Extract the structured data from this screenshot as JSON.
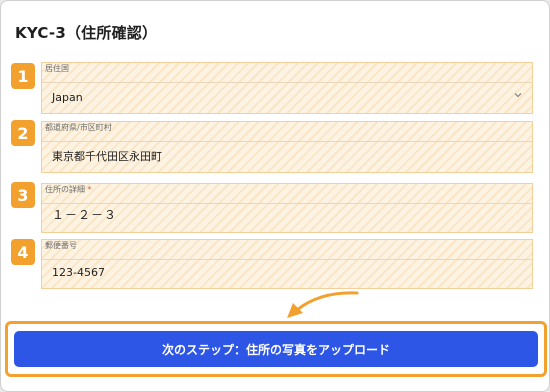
{
  "page": {
    "title": "KYC-3（住所確認）"
  },
  "fields": [
    {
      "step": "1",
      "label": "居住国",
      "required": false,
      "value": "Japan",
      "type": "select"
    },
    {
      "step": "2",
      "label": "都道府県/市区町村",
      "required": false,
      "value": "東京都千代田区永田町",
      "type": "text"
    },
    {
      "step": "3",
      "label": "住所の詳細",
      "required": true,
      "required_mark": "*",
      "value": "１－２－３",
      "type": "text"
    },
    {
      "step": "4",
      "label": "郵便番号",
      "required": false,
      "value": "123-4567",
      "type": "text"
    }
  ],
  "next_button": {
    "label": "次のステップ：住所の写真をアップロード"
  },
  "colors": {
    "accent": "#f2a12e",
    "primary": "#2d55e6",
    "highlight": "#fdf3e3"
  }
}
